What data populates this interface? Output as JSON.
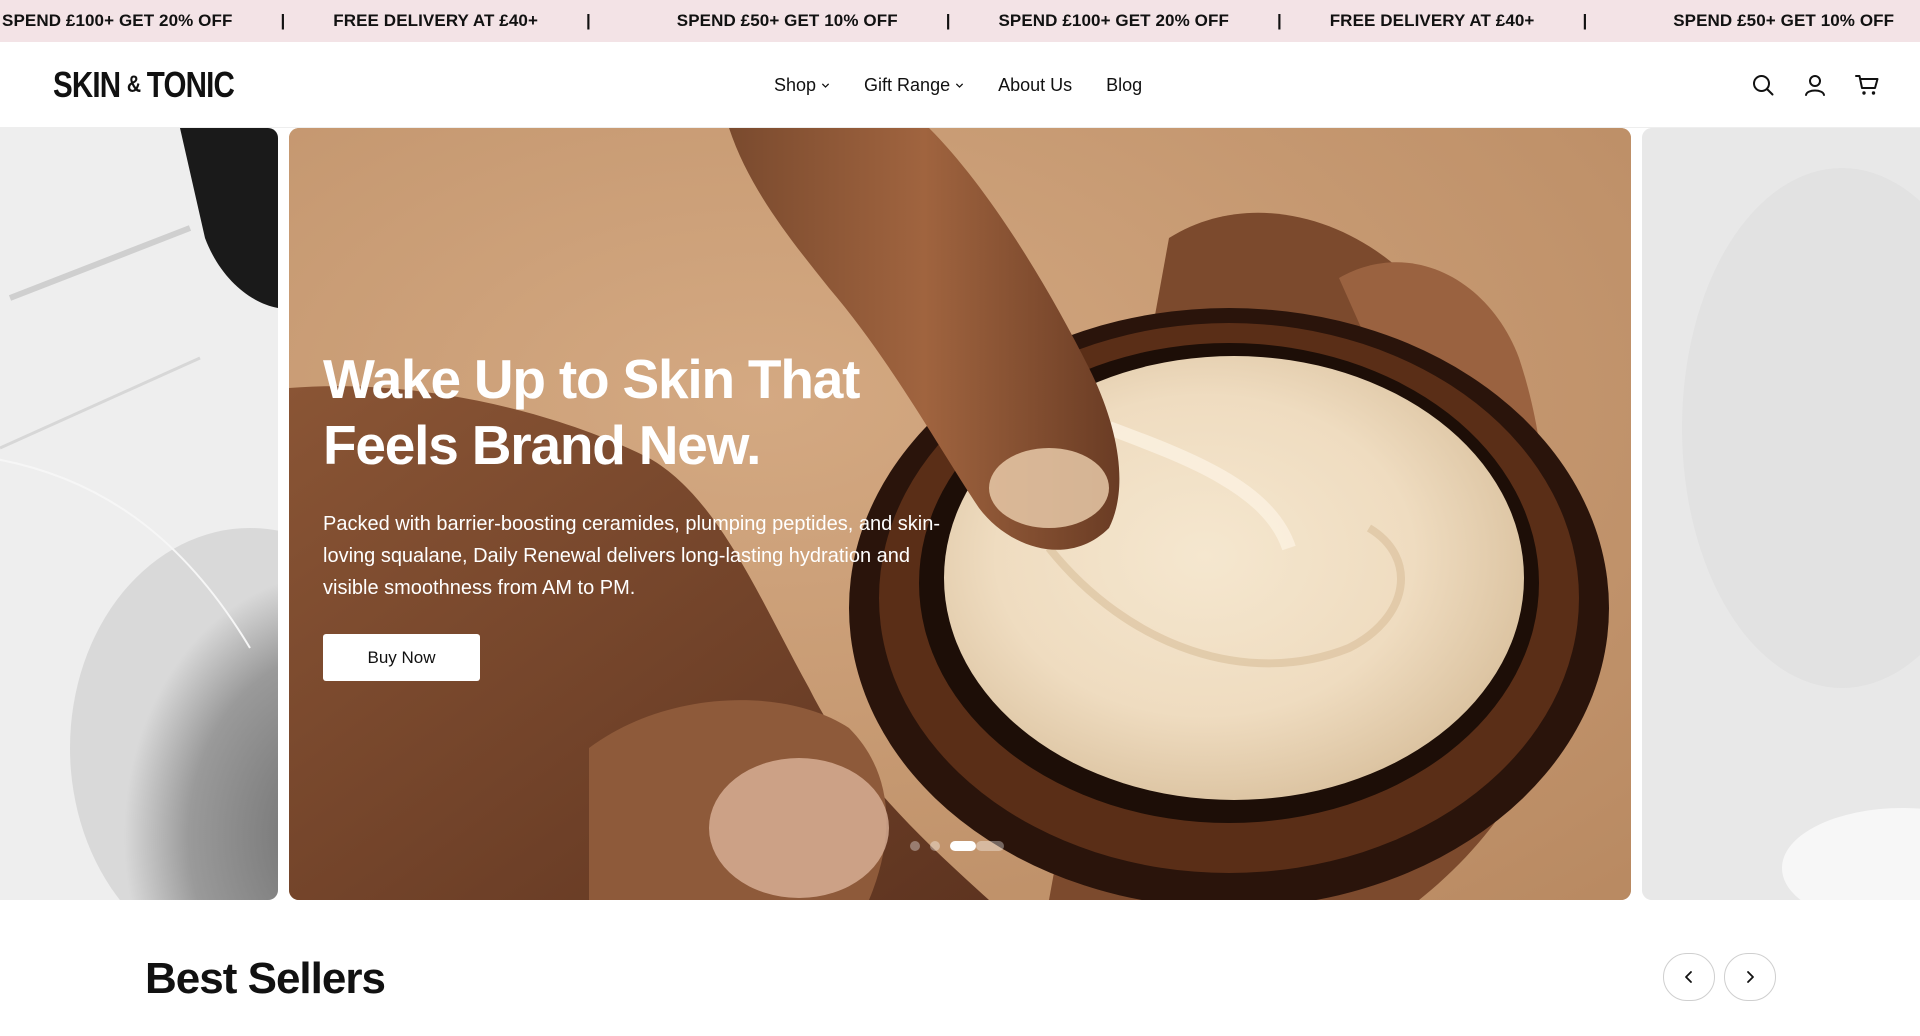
{
  "announcement": {
    "items": [
      "SPEND £100+ GET 20% OFF",
      "FREE DELIVERY AT £40+",
      "SPEND £50+ GET 10% OFF",
      "SPEND £100+ GET 20% OFF",
      "FREE DELIVERY AT £40+",
      "SPEND £50+ GET 10% OFF"
    ],
    "separator": "|",
    "background": "#f3e3e6"
  },
  "header": {
    "logo": {
      "left": "SKIN",
      "amp": "&",
      "right": "TONIC"
    },
    "nav": [
      {
        "label": "Shop",
        "has_dropdown": true
      },
      {
        "label": "Gift Range",
        "has_dropdown": true
      },
      {
        "label": "About Us",
        "has_dropdown": false
      },
      {
        "label": "Blog",
        "has_dropdown": false
      }
    ],
    "icons": [
      "search-icon",
      "account-icon",
      "cart-icon"
    ]
  },
  "hero": {
    "title_line1": "Wake Up to Skin That",
    "title_line2": "Feels Brand New.",
    "subtitle": "Packed with barrier-boosting ceramides, plumping peptides, and skin-loving squalane, Daily Renewal delivers long-lasting hydration and visible smoothness from AM to PM.",
    "cta_label": "Buy Now",
    "slide_count": 4,
    "active_slide": 3
  },
  "best_sellers": {
    "title": "Best Sellers",
    "prev_icon": "chevron-left-icon",
    "next_icon": "chevron-right-icon"
  }
}
